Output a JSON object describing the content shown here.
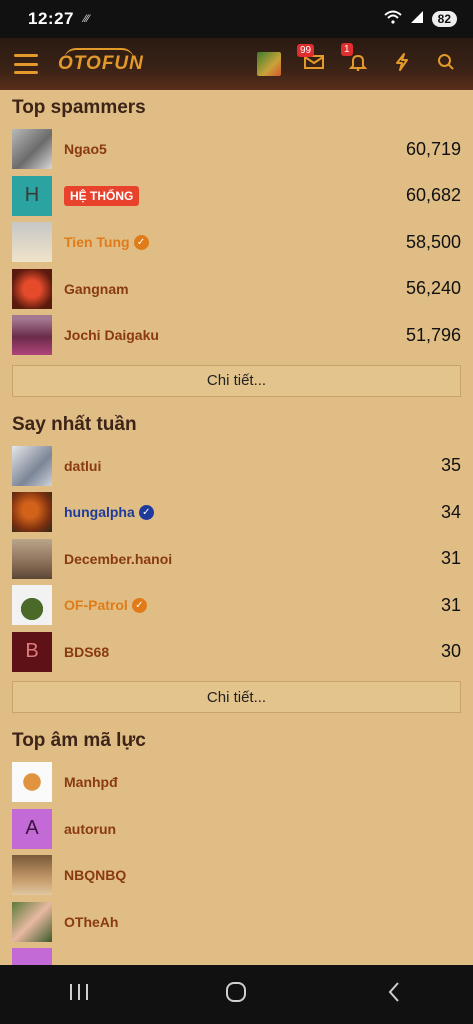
{
  "status": {
    "time": "12:27",
    "battery": "82"
  },
  "app": {
    "logo": "OTOFUN",
    "messages_badge": "99",
    "notifications_badge": "1"
  },
  "top_spammers": {
    "title": "Top spammers",
    "rows": [
      {
        "name": "Ngao5",
        "value": "60,719"
      },
      {
        "avatar_letter": "H",
        "tag": "HỆ THỐNG",
        "value": "60,682"
      },
      {
        "name": "Tien Tung",
        "value": "58,500"
      },
      {
        "name": "Gangnam",
        "value": "56,240"
      },
      {
        "name": "Jochi Daigaku",
        "value": "51,796"
      }
    ],
    "detail_label": "Chi tiết..."
  },
  "say_nhat_tuan": {
    "title": "Say nhất tuần",
    "rows": [
      {
        "name": "datlui",
        "value": "35"
      },
      {
        "name": "hungalpha",
        "value": "34"
      },
      {
        "name": "December.hanoi",
        "value": "31"
      },
      {
        "name": "OF-Patrol",
        "value": "31"
      },
      {
        "avatar_letter": "B",
        "name": "BDS68",
        "value": "30"
      }
    ],
    "detail_label": "Chi tiết..."
  },
  "top_am_ma_luc": {
    "title": "Top âm mã lực",
    "rows": [
      {
        "name": "Manhpđ"
      },
      {
        "avatar_letter": "A",
        "name": "autorun"
      },
      {
        "name": "NBQNBQ"
      },
      {
        "name": "OTheAh"
      }
    ]
  },
  "icons": {
    "menu": "hamburger-icon",
    "messages": "envelope-icon",
    "notifications": "bell-icon",
    "whats_new": "lightning-icon",
    "search": "search-icon",
    "verified": "check-badge-icon"
  },
  "colors": {
    "background": "#dfbd85",
    "accent": "#e39a2a",
    "username": "#8a3a10",
    "staff": "#e07b18",
    "system_tag": "#e8412c"
  }
}
